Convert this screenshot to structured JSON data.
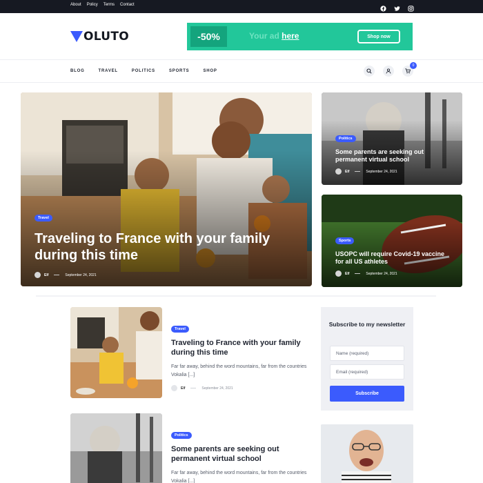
{
  "topbar": {
    "links": [
      "About",
      "Policy",
      "Terms",
      "Contact"
    ],
    "social_icons": [
      "facebook-icon",
      "twitter-icon",
      "instagram-icon"
    ]
  },
  "brand": {
    "logo_text": "OLUTO",
    "accent": "#3b5bfd"
  },
  "ad": {
    "badge": "-50%",
    "text_prefix": "Your ad ",
    "text_link": "here",
    "button": "Shop now",
    "color": "#22c79a"
  },
  "nav": {
    "items": [
      "BLOG",
      "TRAVEL",
      "POLITICS",
      "SPORTS",
      "SHOP"
    ],
    "cart_count": "0"
  },
  "hero": {
    "main": {
      "tag": "Travel",
      "title": "Traveling to France with your family during this time",
      "author": "Elf",
      "date": "September 24, 2021"
    },
    "side": [
      {
        "tag": "Politics",
        "title": "Some parents are seeking out permanent virtual school",
        "author": "Elf",
        "date": "September 24, 2021"
      },
      {
        "tag": "Sports",
        "title": "USOPC will require Covid-19 vaccine for all US athletes",
        "author": "Elf",
        "date": "September 24, 2021"
      }
    ]
  },
  "posts": [
    {
      "tag": "Travel",
      "title": "Traveling to France with your family during this time",
      "excerpt": "Far far away, behind the word mountains, far from the countries Vokalia [...]",
      "author": "Elf",
      "date": "September 24, 2021"
    },
    {
      "tag": "Politics",
      "title": "Some parents are seeking out permanent virtual school",
      "excerpt": "Far far away, behind the word mountains, far from the countries Vokalia [...]"
    }
  ],
  "newsletter": {
    "title": "Subscribe to my newsletter",
    "name_placeholder": "Name (required)",
    "email_placeholder": "Email (required)",
    "button": "Subscribe"
  }
}
